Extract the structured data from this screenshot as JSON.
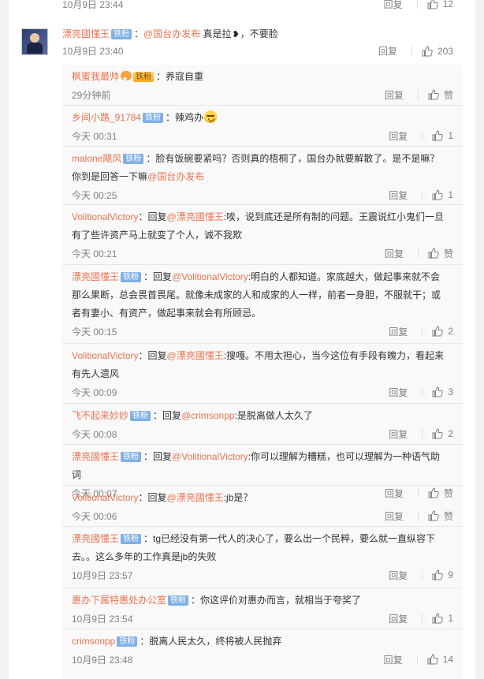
{
  "top_partial": {
    "time": "10月9日 23:44",
    "reply_label": "回复",
    "likes": "12"
  },
  "main_comment": {
    "author": "漂亮國懂王",
    "badge": "铁粉",
    "colon": "：",
    "mention": "@国台办发布",
    "text_before_emoji": " 真是拉",
    "text_after_emoji": "，不要脸",
    "time": "10月9日 23:40",
    "reply_label": "回复",
    "likes": "203"
  },
  "replies": [
    {
      "author": "枫蜜我最帅",
      "badge": "铁粉",
      "badge_style": "gold",
      "vip": true,
      "body": "：养寇自重",
      "time": "29分钟前",
      "reply_label": "回复",
      "likes": "赞"
    },
    {
      "author": "乡间小路_91784",
      "badge": "铁粉",
      "body": "：辣鸡办",
      "emoji": true,
      "time": "今天 00:31",
      "reply_label": "回复",
      "likes": "1"
    },
    {
      "author": "malone飓风",
      "badge": "铁粉",
      "body": "：脸有饭碗要紧吗？否则真的梧桐了，国台办就要解散了。是不是嘛？你到是回答一下嘛",
      "mention_end": "@国台办发布",
      "time": "今天 00:25",
      "reply_label": "回复",
      "likes": "1"
    },
    {
      "author": "VolitionalVictory",
      "body_prefix": "：回复",
      "mention": "@漂亮國懂王",
      "body": ":唉，说到底还是所有制的问题。王震说红小鬼们一旦有了些许资产马上就变了个人，诚不我欺",
      "time": "今天 00:21",
      "reply_label": "回复",
      "likes": "赞"
    },
    {
      "author": "漂亮國懂王",
      "badge": "铁粉",
      "body_prefix": "：回复",
      "mention": "@VolitionalVictory",
      "body": ":明白的人都知道。家底越大，做起事来就不会那么果断，总会畏首畏尾。就像未成家的人和成家的人一样，前者一身胆，不服就干；或者有妻小、有资产，做起事来就会有所顾忌。",
      "time": "今天 00:15",
      "reply_label": "回复",
      "likes": "2"
    },
    {
      "author": "VolitionalVictory",
      "body_prefix": "：回复",
      "mention": "@漂亮國懂王",
      "body": ":搜嘎。不用太担心，当今这位有手段有魄力，看起来有先人遗风",
      "time": "今天 00:09",
      "reply_label": "回复",
      "likes": "3"
    },
    {
      "author": "飞不起来妙妙",
      "badge": "铁粉",
      "body_prefix": "：回复",
      "mention": "@crimsonpp",
      "body": ":是脱离做人太久了",
      "time": "今天 00:08",
      "reply_label": "回复",
      "likes": "2"
    },
    {
      "author": "漂亮國懂王",
      "badge": "铁粉",
      "body_prefix": "：回复",
      "mention": "@VolitionalVictory",
      "body": ":你可以理解为糟糕，也可以理解为一种语气助词",
      "time": "今天 00:07",
      "reply_label": "回复",
      "likes": "赞"
    },
    {
      "author": "VolitionalVictory",
      "body_prefix": "：回复",
      "mention": "@漂亮國懂王",
      "body": ":jb是？",
      "time": "今天 00:06",
      "reply_label": "回复",
      "likes": "赞"
    },
    {
      "author": "漂亮國懂王",
      "badge": "铁粉",
      "body": "：tg已经没有第一代人的决心了，要么出一个民粹，要么就一直纵容下去。。这么多年的工作真是jb的失败",
      "time": "10月9日 23:57",
      "reply_label": "回复",
      "likes": "9"
    },
    {
      "author": "惠办下属特惠处办公室",
      "badge": "铁粉",
      "body": "：你这评价对惠办而言，就相当于夸奖了",
      "time": "10月9日 23:54",
      "reply_label": "回复",
      "likes": "1"
    },
    {
      "author": "crimsonpp",
      "badge": "铁粉",
      "body": "：脱离人民太久，终将被人民抛弃",
      "time": "10月9日 23:48",
      "reply_label": "回复",
      "likes": "14"
    }
  ],
  "colors": {
    "name": "#eb7350",
    "badge": "#7fb0e6",
    "meta": "#808080",
    "reply_bg": "#f9f9f9"
  },
  "icons": {
    "like": "thumbs-up-icon",
    "heart_emoji": "heart-emoji-icon",
    "face_emoji": "face-emoji-icon",
    "vip": "vip-heart-icon"
  }
}
